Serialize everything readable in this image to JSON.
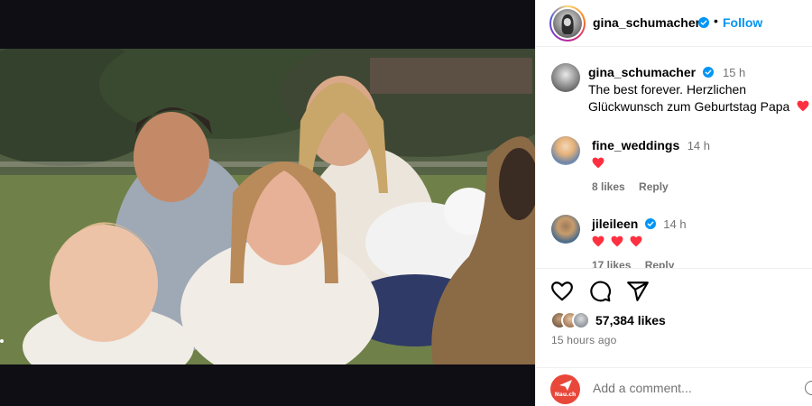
{
  "post": {
    "username": "gina_schumacher",
    "verified": true,
    "follow_label": "Follow",
    "separator": "•"
  },
  "caption": {
    "username": "gina_schumacher",
    "time": "15 h",
    "line1": "The best forever. Herzlichen",
    "line2": "Glückwunsch zum Geburtstag Papa"
  },
  "comments": [
    {
      "username": "fine_weddings",
      "time": "14 h",
      "hearts": 1,
      "likes": "8 likes",
      "reply": "Reply"
    },
    {
      "username": "jileileen",
      "verified": true,
      "time": "14 h",
      "hearts": 3,
      "likes": "17 likes",
      "reply": "Reply"
    }
  ],
  "stats": {
    "likes": "57,384 likes",
    "posted": "15 hours ago"
  },
  "add_comment": {
    "placeholder": "Add a comment...",
    "avatar_text": "Nau.ch"
  },
  "colors": {
    "accent": "#0095f6",
    "verified": "#0095f6",
    "heart": "#ff3040",
    "avatar_brand": "#e8473a",
    "media_bg": "#0e0e14"
  },
  "icons": [
    "verified-badge-icon",
    "heart-icon",
    "comment-icon",
    "share-icon",
    "emoji-icon"
  ]
}
